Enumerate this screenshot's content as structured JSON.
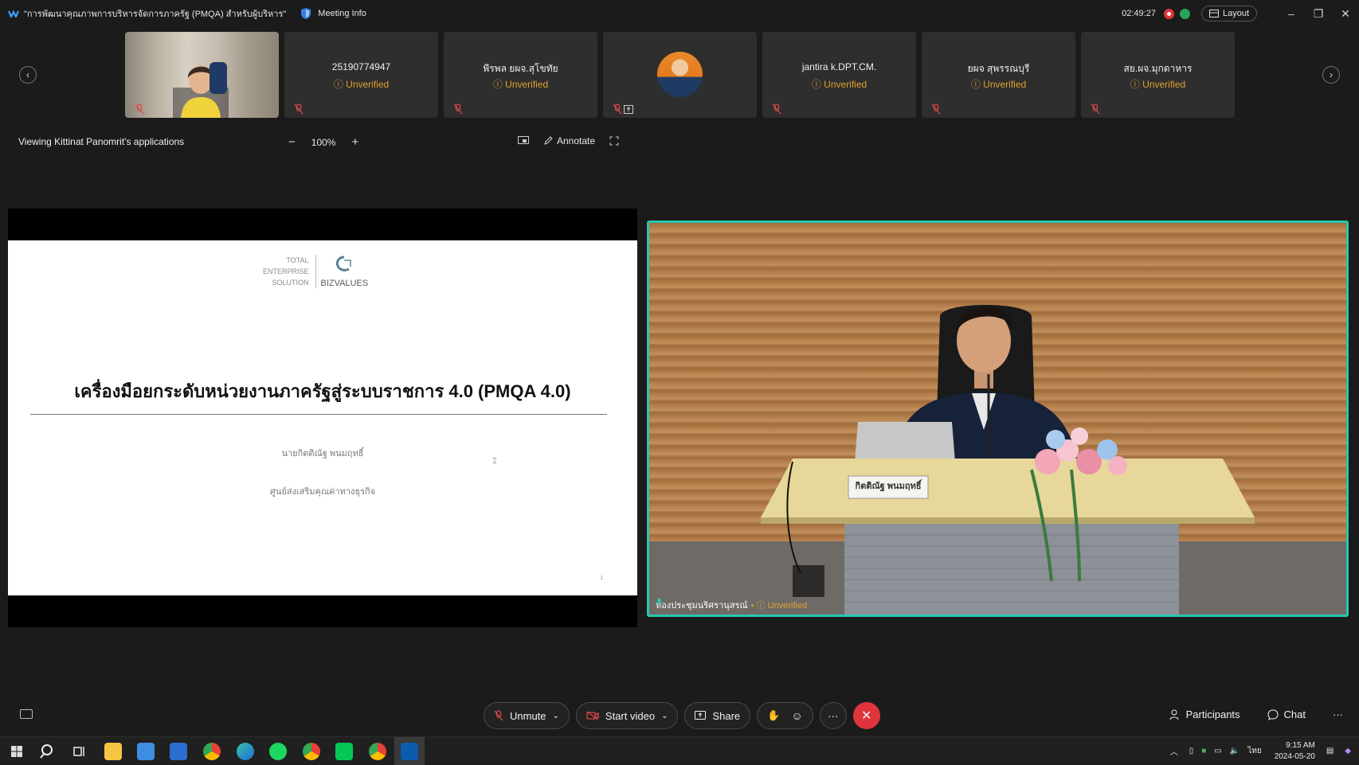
{
  "window": {
    "title": "\"การพัฒนาคุณภาพการบริหารจัดการภาครัฐ (PMQA) สำหรับผู้บริหาร\"",
    "meeting_info": "Meeting Info",
    "timer": "02:49:27",
    "layout_label": "Layout"
  },
  "participants_strip": [
    {
      "name": "",
      "status": "",
      "type": "video"
    },
    {
      "name": "25190774947",
      "status": "Unverified"
    },
    {
      "name": "พีรพล ยผจ.สุโขทัย",
      "status": "Unverified"
    },
    {
      "name": "",
      "status": "",
      "type": "avatar"
    },
    {
      "name": "jantira k.DPT.CM.",
      "status": "Unverified"
    },
    {
      "name": "ยผจ สุพรรณบุรี",
      "status": "Unverified"
    },
    {
      "name": "สย.ผจ.มุกดาหาร",
      "status": "Unverified"
    }
  ],
  "share_bar": {
    "viewing_text": "Viewing Kittinat Panomrit's applications",
    "zoom": "100%",
    "annotate": "Annotate"
  },
  "slide": {
    "brand_left": [
      "TOTAL",
      "ENTERPRISE",
      "SOLUTION"
    ],
    "brand_name": "BIZVALUES",
    "title": "เครื่องมือยกระดับหน่วยงานภาครัฐสู่ระบบราชการ 4.0 (PMQA 4.0)",
    "presenter": "นายกิตติณัฐ พนมฤทธิ์",
    "organization": "ศูนย์ส่งเสริมคุณค่าทางธุรกิจ",
    "page": "1"
  },
  "speaker_video": {
    "name": "ห้องประชุมนริศรานุสรณ์",
    "status": "Unverified",
    "nameplate": "กิตติณัฐ พนมฤทธิ์"
  },
  "toolbar": {
    "unmute": "Unmute",
    "start_video": "Start video",
    "share": "Share",
    "participants": "Participants",
    "chat": "Chat"
  },
  "taskbar": {
    "time": "9:15 AM",
    "date": "2024-05-20",
    "lang": "ไทย"
  },
  "colors": {
    "accent_active_speaker": "#29c7b0",
    "unverified": "#e0a030",
    "end_call": "#e0343c"
  }
}
